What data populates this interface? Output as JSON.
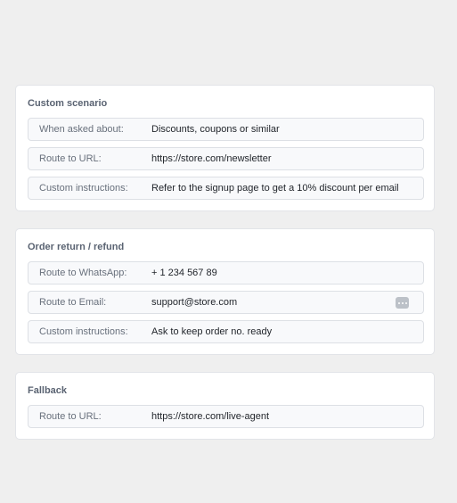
{
  "cards": [
    {
      "title": "Custom scenario",
      "rows": [
        {
          "label": "When asked about:",
          "value": "Discounts, coupons or similar"
        },
        {
          "label": "Route to URL:",
          "value": "https://store.com/newsletter"
        },
        {
          "label": "Custom instructions:",
          "value": "Refer to the signup page to get a 10% discount per email"
        }
      ]
    },
    {
      "title": "Order return / refund",
      "rows": [
        {
          "label": "Route to WhatsApp:",
          "value": "+ 1 234 567 89"
        },
        {
          "label": "Route to Email:",
          "value": "support@store.com",
          "icon": "more-options-icon"
        },
        {
          "label": "Custom instructions:",
          "value": "Ask to keep order no. ready"
        }
      ]
    },
    {
      "title": "Fallback",
      "rows": [
        {
          "label": "Route to URL:",
          "value": "https://store.com/live-agent"
        }
      ]
    }
  ]
}
